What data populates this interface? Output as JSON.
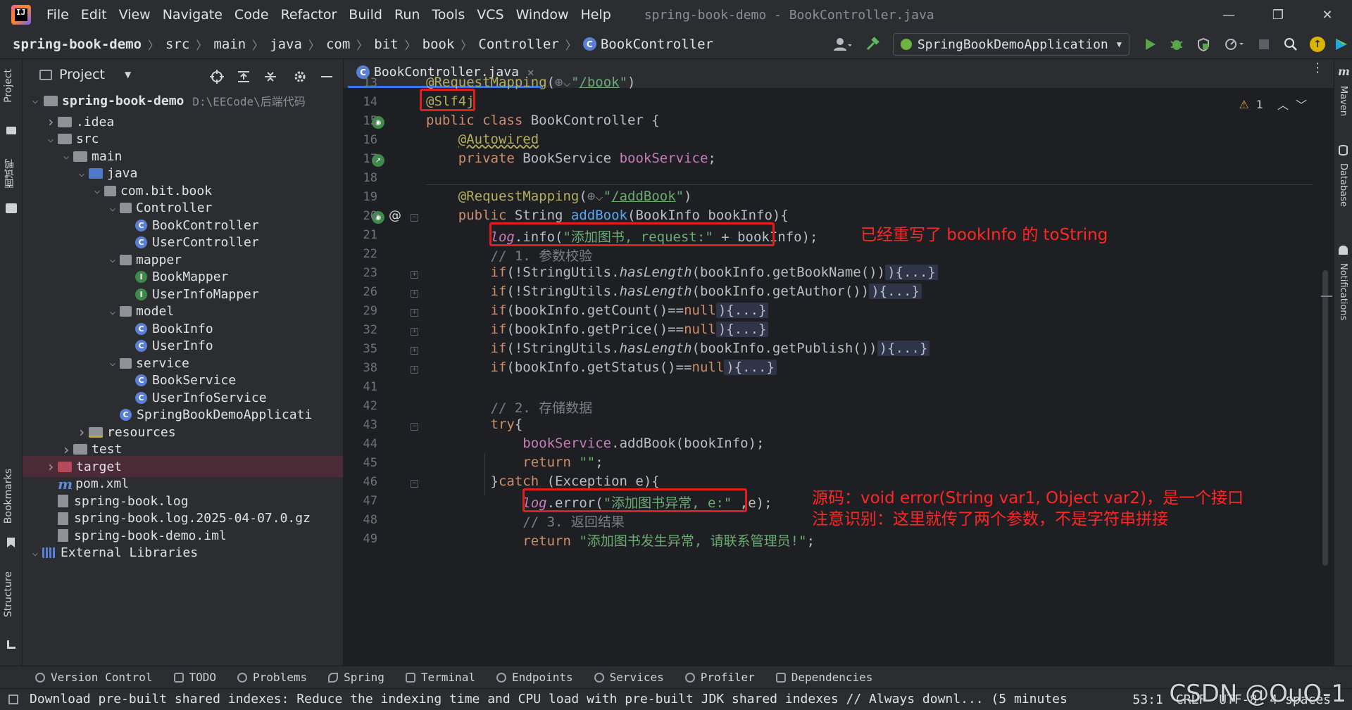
{
  "menubar": {
    "items": [
      "File",
      "Edit",
      "View",
      "Navigate",
      "Code",
      "Refactor",
      "Build",
      "Run",
      "Tools",
      "VCS",
      "Window",
      "Help"
    ],
    "window_title": "spring-book-demo - BookController.java"
  },
  "breadcrumb": [
    "spring-book-demo",
    "src",
    "main",
    "java",
    "com",
    "bit",
    "book",
    "Controller",
    "BookController"
  ],
  "run_config": "SpringBookDemoApplication",
  "left_strip": {
    "project": "Project",
    "cn": "面试鸭",
    "bookmarks": "Bookmarks",
    "structure": "Structure"
  },
  "project_panel": {
    "title": "Project",
    "root_name": "spring-book-demo",
    "root_path": "D:\\EECode\\后端代码",
    "tree": [
      {
        "label": ".idea",
        "depth": 1,
        "type": "folder",
        "open": false
      },
      {
        "label": "src",
        "depth": 1,
        "type": "folder",
        "open": true
      },
      {
        "label": "main",
        "depth": 2,
        "type": "folder",
        "open": true
      },
      {
        "label": "java",
        "depth": 3,
        "type": "folder-blue",
        "open": true
      },
      {
        "label": "com.bit.book",
        "depth": 4,
        "type": "package",
        "open": true
      },
      {
        "label": "Controller",
        "depth": 5,
        "type": "package",
        "open": true
      },
      {
        "label": "BookController",
        "depth": 6,
        "type": "class"
      },
      {
        "label": "UserController",
        "depth": 6,
        "type": "class"
      },
      {
        "label": "mapper",
        "depth": 5,
        "type": "package",
        "open": true
      },
      {
        "label": "BookMapper",
        "depth": 6,
        "type": "interface"
      },
      {
        "label": "UserInfoMapper",
        "depth": 6,
        "type": "interface"
      },
      {
        "label": "model",
        "depth": 5,
        "type": "package",
        "open": true
      },
      {
        "label": "BookInfo",
        "depth": 6,
        "type": "class"
      },
      {
        "label": "UserInfo",
        "depth": 6,
        "type": "class"
      },
      {
        "label": "service",
        "depth": 5,
        "type": "package",
        "open": true
      },
      {
        "label": "BookService",
        "depth": 6,
        "type": "class"
      },
      {
        "label": "UserInfoService",
        "depth": 6,
        "type": "class"
      },
      {
        "label": "SpringBookDemoApplicati",
        "depth": 5,
        "type": "class"
      },
      {
        "label": "resources",
        "depth": 3,
        "type": "folder-res",
        "open": false
      },
      {
        "label": "test",
        "depth": 2,
        "type": "folder",
        "open": false
      },
      {
        "label": "target",
        "depth": 1,
        "type": "folder-red",
        "open": false
      },
      {
        "label": "pom.xml",
        "depth": 1,
        "type": "maven"
      },
      {
        "label": "spring-book.log",
        "depth": 1,
        "type": "file"
      },
      {
        "label": "spring-book.log.2025-04-07.0.gz",
        "depth": 1,
        "type": "file"
      },
      {
        "label": "spring-book-demo.iml",
        "depth": 1,
        "type": "file"
      },
      {
        "label": "External Libraries",
        "depth": 0,
        "type": "lib",
        "open": true
      }
    ]
  },
  "editor": {
    "tab": "BookController.java",
    "warnings": "1",
    "line_numbers": [
      "13",
      "14",
      "15",
      "16",
      "17",
      "18",
      "19",
      "20",
      "21",
      "22",
      "23",
      "26",
      "29",
      "32",
      "35",
      "38",
      "41",
      "42",
      "43",
      "44",
      "45",
      "46",
      "47",
      "48",
      "49"
    ],
    "callouts": {
      "log_info": "已经重写了 bookInfo 的 toString",
      "log_error_1": "源码：void error(String var1, Object var2)，是一个接口",
      "log_error_2": "注意识别：这里就传了两个参数，不是字符串拼接"
    }
  },
  "right_strip": {
    "maven": "Maven",
    "database": "Database",
    "notifications": "Notifications"
  },
  "toolwin_bar": [
    "Version Control",
    "TODO",
    "Problems",
    "Spring",
    "Terminal",
    "Endpoints",
    "Services",
    "Profiler",
    "Dependencies"
  ],
  "statusbar": {
    "message": "Download pre-built shared indexes: Reduce the indexing time and CPU load with pre-built JDK shared indexes // Always downl... (5 minutes",
    "position": "53:1",
    "line_sep": "CRLF",
    "encoding": "UTF-8",
    "indent": "4 spaces"
  },
  "watermark": "CSDN @OuO-1"
}
